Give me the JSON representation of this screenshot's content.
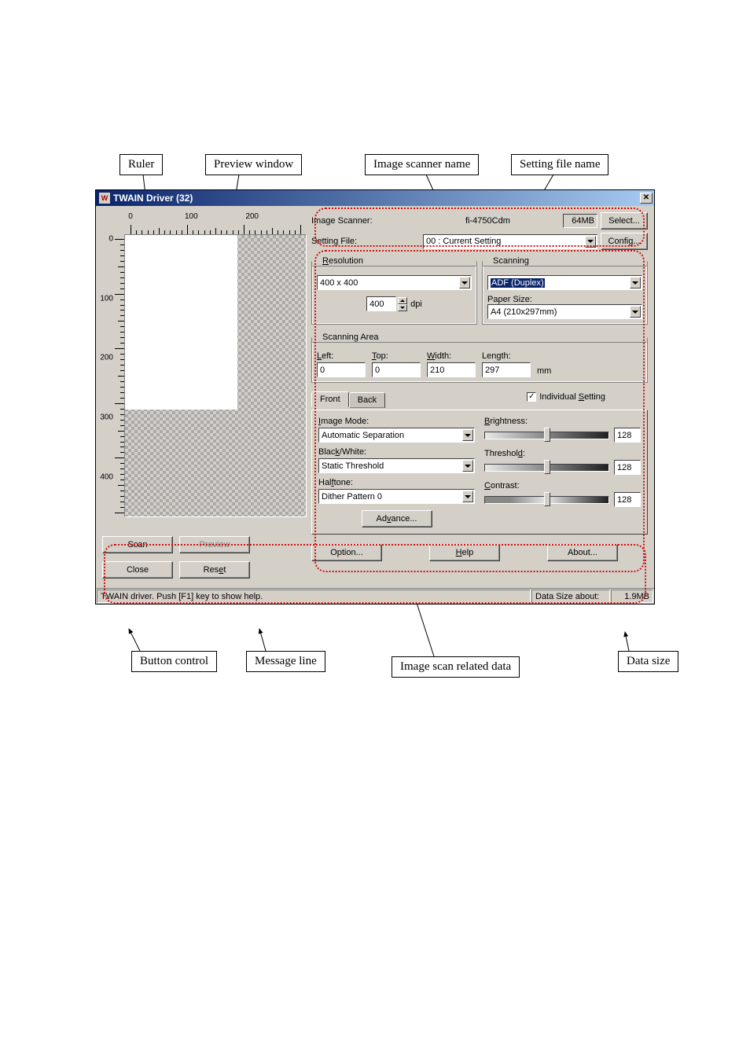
{
  "callouts": {
    "ruler": "Ruler",
    "preview_window": "Preview window",
    "image_scanner_name": "Image scanner name",
    "setting_file_name": "Setting file name",
    "button_control": "Button control",
    "message_line": "Message line",
    "image_scan_related_data": "Image scan related data",
    "data_size": "Data size"
  },
  "window": {
    "title": "TWAIN Driver (32)"
  },
  "ruler": {
    "h": [
      "0",
      "100",
      "200"
    ],
    "v": [
      "0",
      "100",
      "200",
      "300",
      "400"
    ]
  },
  "header": {
    "scanner_label": "Image Scanner:",
    "scanner_value": "fi-4750Cdm",
    "mem": "64MB",
    "select_btn": "Select...",
    "setting_label": "Setting File:",
    "setting_value": "00 : Current Setting",
    "config_btn": "Config..."
  },
  "resolution": {
    "legend": "Resolution",
    "preset": "400 x 400",
    "value": "400",
    "unit": "dpi"
  },
  "scanning": {
    "legend": "Scanning",
    "type": "ADF (Duplex)",
    "paper_label": "Paper Size:",
    "paper_value": "A4 (210x297mm)"
  },
  "scan_area": {
    "legend": "Scanning Area",
    "left_label": "Left:",
    "top_label": "Top:",
    "width_label": "Width:",
    "length_label": "Length:",
    "left": "0",
    "top": "0",
    "width": "210",
    "length": "297",
    "unit": "mm"
  },
  "individual_setting": {
    "front_tab": "Front",
    "back_tab": "Back",
    "checkbox_label": "Individual Setting"
  },
  "image": {
    "mode_label": "Image Mode:",
    "mode_value": "Automatic Separation",
    "bw_label": "Black/White:",
    "bw_value": "Static Threshold",
    "halftone_label": "Halftone:",
    "halftone_value": "Dither Pattern 0",
    "advance_btn": "Advance..."
  },
  "sliders": {
    "brightness_label": "Brightness:",
    "brightness_value": "128",
    "threshold_label": "Threshold:",
    "threshold_value": "128",
    "contrast_label": "Contrast:",
    "contrast_value": "128"
  },
  "buttons": {
    "scan": "Scan",
    "preview": "Preview",
    "close": "Close",
    "reset": "Reset",
    "option": "Option...",
    "help": "Help",
    "about": "About..."
  },
  "status": {
    "message": "TWAIN driver. Push [F1] key to show help.",
    "datasize_label": "Data Size about:",
    "datasize_value": "1.9MB"
  }
}
